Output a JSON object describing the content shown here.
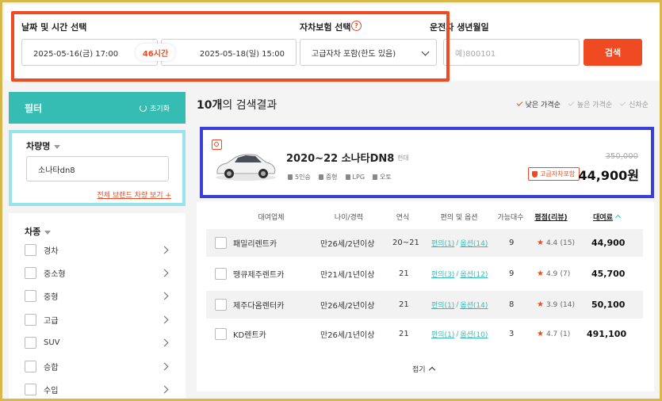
{
  "search": {
    "datetime_label": "날짜 및 시간 선택",
    "pickup": "2025-05-16(금) 17:00",
    "duration": "46시간",
    "return": "2025-05-18(일) 15:00",
    "insurance_label": "자차보험 선택",
    "insurance_value": "고급자차 포함(한도 있음)",
    "birth_label": "운전자 생년월일",
    "birth_placeholder": "예)800101",
    "search_button": "검색"
  },
  "filter": {
    "title": "필터",
    "reset": "초기화",
    "car_name_title": "차량명",
    "car_name_value": "소나타dn8",
    "brand_link": "전체 브랜드 차량 보기 +",
    "class_title": "차종",
    "classes": [
      "경차",
      "중소형",
      "중형",
      "고급",
      "SUV",
      "승합",
      "수입"
    ]
  },
  "results": {
    "count_prefix": "10개",
    "count_suffix": "의 검색결과",
    "sorts": [
      "낮은 가격순",
      "높은 가격순",
      "신차순"
    ]
  },
  "car": {
    "name": "2020~22 소나타DN8",
    "maker": "현대",
    "specs": [
      "5인승",
      "중형",
      "LPG",
      "오토"
    ],
    "original_price": "350,000",
    "insurance_badge": "고급자차포함",
    "price": "44,900원"
  },
  "table": {
    "headers": [
      "대여업체",
      "나이/경력",
      "연식",
      "편의 및 옵션",
      "가능대수",
      "평점(리뷰)",
      "대여료"
    ],
    "rows": [
      {
        "company": "패밀리렌트카",
        "age": "만26세/2년이상",
        "year": "20~21",
        "conv": "편의(1)",
        "opt": "옵션(14)",
        "avail": "9",
        "rating": "4.4",
        "reviews": "(15)",
        "fee": "44,900"
      },
      {
        "company": "땡큐제주렌트카",
        "age": "만21세/1년이상",
        "year": "21",
        "conv": "편의(3)",
        "opt": "옵션(12)",
        "avail": "9",
        "rating": "4.9",
        "reviews": "(7)",
        "fee": "45,700"
      },
      {
        "company": "제주다옴렌터카",
        "age": "만26세/2년이상",
        "year": "21",
        "conv": "편의(1)",
        "opt": "옵션(14)",
        "avail": "8",
        "rating": "3.9",
        "reviews": "(14)",
        "fee": "50,100"
      },
      {
        "company": "KD렌트카",
        "age": "만26세/1년이상",
        "year": "21",
        "conv": "편의(1)",
        "opt": "옵션(10)",
        "avail": "3",
        "rating": "4.7",
        "reviews": "(1)",
        "fee": "491,100"
      }
    ],
    "fold": "접기"
  },
  "colors": {
    "accent": "#ef4a22",
    "teal": "#36bdb3",
    "highlight_blue": "#3b3fd8",
    "highlight_cyan": "#98e3ee"
  }
}
